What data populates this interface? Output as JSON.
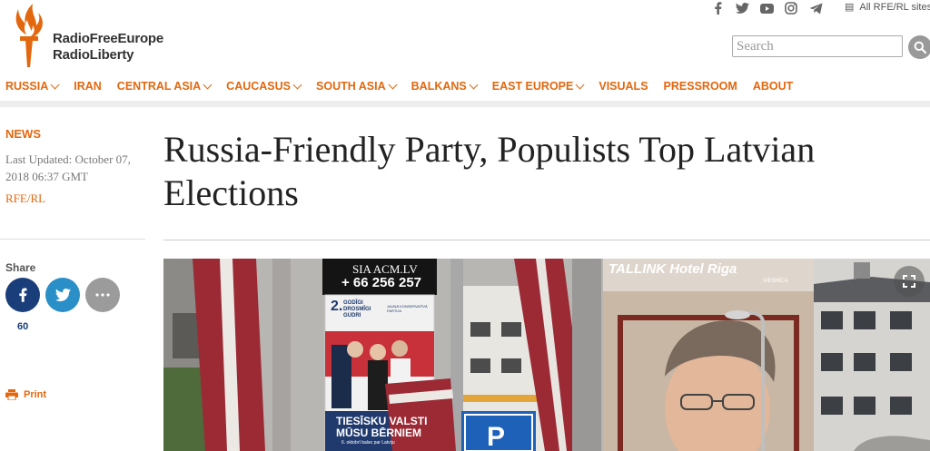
{
  "brand": {
    "line1": "RadioFreeEurope",
    "line2": "RadioLiberty",
    "color": "#e3670e"
  },
  "social": {
    "icons": [
      "facebook-icon",
      "twitter-icon",
      "youtube-icon",
      "instagram-icon",
      "telegram-icon"
    ],
    "all_sites_label": "All RFE/RL sites"
  },
  "search": {
    "placeholder": "Search"
  },
  "nav": {
    "items": [
      {
        "label": "RUSSIA",
        "dropdown": true
      },
      {
        "label": "IRAN",
        "dropdown": false
      },
      {
        "label": "CENTRAL ASIA",
        "dropdown": true
      },
      {
        "label": "CAUCASUS",
        "dropdown": true
      },
      {
        "label": "SOUTH ASIA",
        "dropdown": true
      },
      {
        "label": "BALKANS",
        "dropdown": true
      },
      {
        "label": "EAST EUROPE",
        "dropdown": true
      },
      {
        "label": "VISUALS",
        "dropdown": false
      },
      {
        "label": "PRESSROOM",
        "dropdown": false
      },
      {
        "label": "ABOUT",
        "dropdown": false
      }
    ]
  },
  "article": {
    "section": "NEWS",
    "updated": "Last Updated: October 07, 2018 06:37 GMT",
    "source": "RFE/RL",
    "title": "Russia-Friendly Party, Populists Top Latvian Elections"
  },
  "share": {
    "label": "Share",
    "count": "60",
    "print_label": "Print",
    "colors": {
      "facebook": "#1a3e7a",
      "twitter": "#2a8fc7",
      "more": "#9b9b9b"
    }
  },
  "photo": {
    "billboard_site": "SIA ACM.LV",
    "billboard_phone": "+ 66 256 257",
    "poster_number": "2.",
    "poster_slogan": "GODĪGI DROSMĪGI GUDRI",
    "poster_party": "JAUNĀ KONSERVATĪVĀ PARTIJA",
    "poster_bottom_1": "TIESĪSKU VALSTI",
    "poster_bottom_2": "MŪSU BĒRNIEM",
    "poster_date": "6. oktobrī balso par Latviju",
    "hotel_sign": "TALLINK Hotel Riga",
    "hotel_sub": "VIESNĪCA",
    "parking_sign": "P"
  }
}
